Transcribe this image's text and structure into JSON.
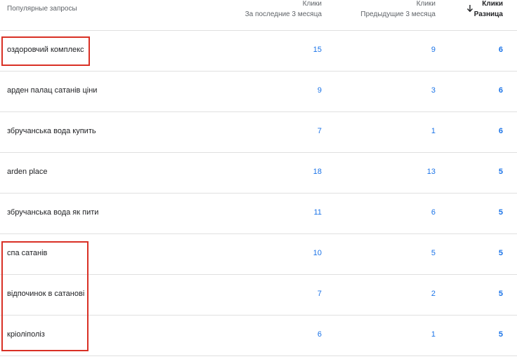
{
  "header": {
    "query_label": "Популярные запросы",
    "col1_line1": "Клики",
    "col1_line2": "За последние 3 месяца",
    "col2_line1": "Клики",
    "col2_line2": "Предыдущие 3 месяца",
    "col3_line1": "Клики",
    "col3_line2": "Разница",
    "sort_icon": "arrow-down-icon"
  },
  "rows": [
    {
      "query": "оздоровчий комплекс",
      "last3": "15",
      "prev3": "9",
      "diff": "6"
    },
    {
      "query": "арден палац сатанів ціни",
      "last3": "9",
      "prev3": "3",
      "diff": "6"
    },
    {
      "query": "збручанська вода купить",
      "last3": "7",
      "prev3": "1",
      "diff": "6"
    },
    {
      "query": "arden place",
      "last3": "18",
      "prev3": "13",
      "diff": "5"
    },
    {
      "query": "збручанська вода як пити",
      "last3": "11",
      "prev3": "6",
      "diff": "5"
    },
    {
      "query": "спа сатанів",
      "last3": "10",
      "prev3": "5",
      "diff": "5"
    },
    {
      "query": "відпочинок в сатанові",
      "last3": "7",
      "prev3": "2",
      "diff": "5"
    },
    {
      "query": "кріоліполіз",
      "last3": "6",
      "prev3": "1",
      "diff": "5"
    }
  ],
  "colors": {
    "value_link": "#1a73e8",
    "highlight_box": "#d93025",
    "divider": "#e0e0e0"
  }
}
